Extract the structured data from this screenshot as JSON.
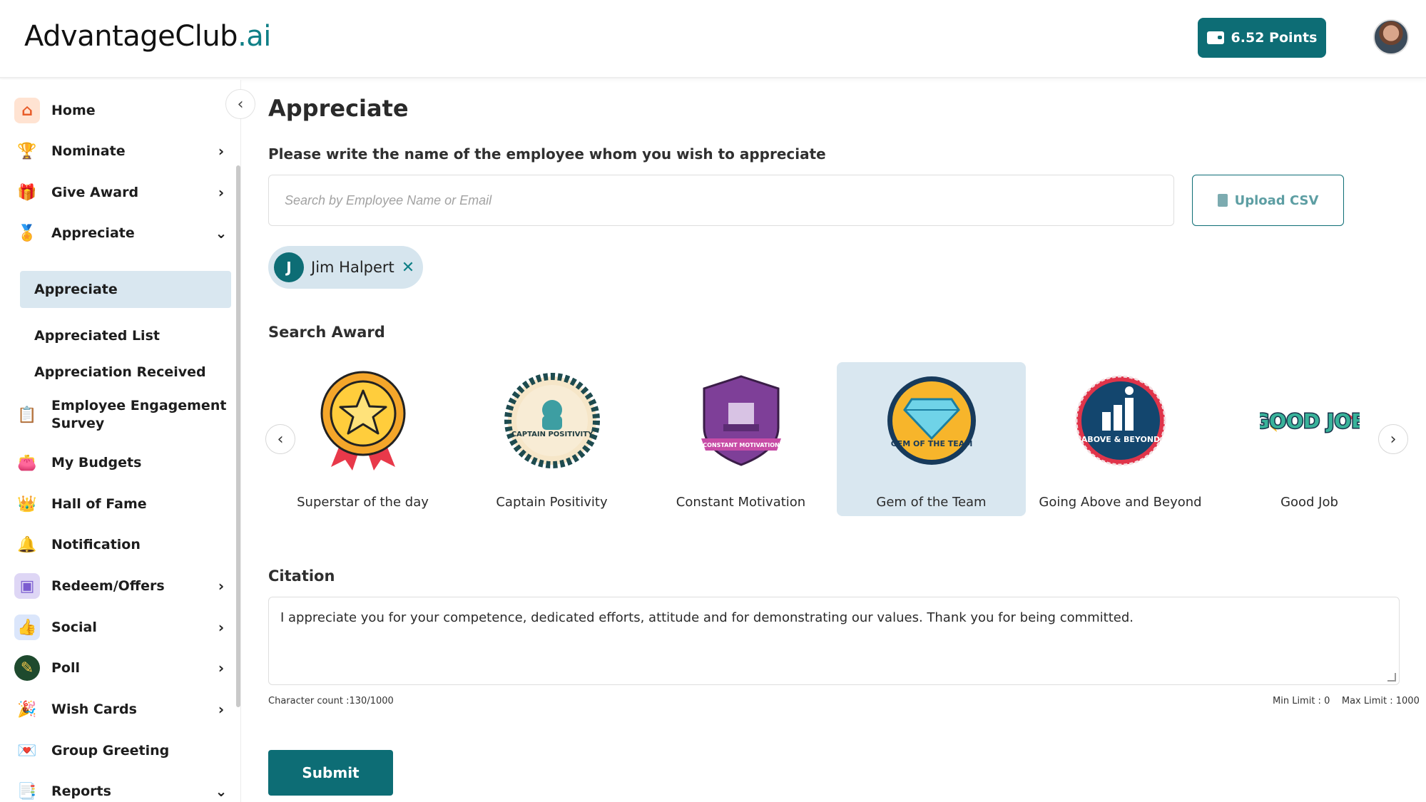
{
  "header": {
    "logo_main": "AdvantageClub",
    "logo_suffix": ".ai",
    "points_label": "6.52  Points"
  },
  "sidebar": {
    "items": [
      {
        "label": "Home",
        "icon": "home-icon"
      },
      {
        "label": "Nominate",
        "icon": "trophy-icon"
      },
      {
        "label": "Give Award",
        "icon": "gift-icon"
      },
      {
        "label": "Appreciate",
        "icon": "medal-icon"
      },
      {
        "label": "Employee Engagement Survey",
        "icon": "survey-icon"
      },
      {
        "label": "My Budgets",
        "icon": "wallet-icon"
      },
      {
        "label": "Hall of Fame",
        "icon": "crown-icon"
      },
      {
        "label": "Notification",
        "icon": "bell-icon"
      },
      {
        "label": "Redeem/Offers",
        "icon": "offers-icon"
      },
      {
        "label": "Social",
        "icon": "social-icon"
      },
      {
        "label": "Poll",
        "icon": "poll-icon"
      },
      {
        "label": "Wish Cards",
        "icon": "party-icon"
      },
      {
        "label": "Group Greeting",
        "icon": "greeting-icon"
      },
      {
        "label": "Reports",
        "icon": "reports-icon"
      }
    ],
    "sub_items": [
      {
        "label": "Appreciate",
        "active": true
      },
      {
        "label": "Appreciated List"
      },
      {
        "label": "Appreciation Received"
      }
    ]
  },
  "main": {
    "title": "Appreciate",
    "prompt": "Please write the name of the employee whom you wish to appreciate",
    "search_placeholder": "Search by Employee Name or Email",
    "upload_label": "Upload CSV",
    "selected_employee": {
      "initial": "J",
      "name": "Jim Halpert"
    },
    "search_award_label": "Search Award",
    "awards": [
      {
        "name": "Superstar of the day"
      },
      {
        "name": "Captain Positivity",
        "art_text": "CAPTAIN POSITIVITY"
      },
      {
        "name": "Constant Motivation",
        "art_text": "CONSTANT MOTIVATION"
      },
      {
        "name": "Gem of the Team",
        "art_text": "GEM OF THE TEAM",
        "selected": true
      },
      {
        "name": "Going Above and Beyond",
        "art_text": "ABOVE & BEYOND"
      },
      {
        "name": "Good Job",
        "art_text": "GOOD JOB"
      }
    ],
    "citation_label": "Citation",
    "citation_text": "I appreciate you for your competence, dedicated efforts, attitude and for demonstrating our values. Thank you for being committed.",
    "char_count": "Character count :130/1000",
    "limits": "Min Limit : 0    Max Limit : 1000",
    "submit_label": "Submit"
  },
  "colors": {
    "brand": "#0d6d75",
    "selected_bg": "#d9e7f0"
  }
}
